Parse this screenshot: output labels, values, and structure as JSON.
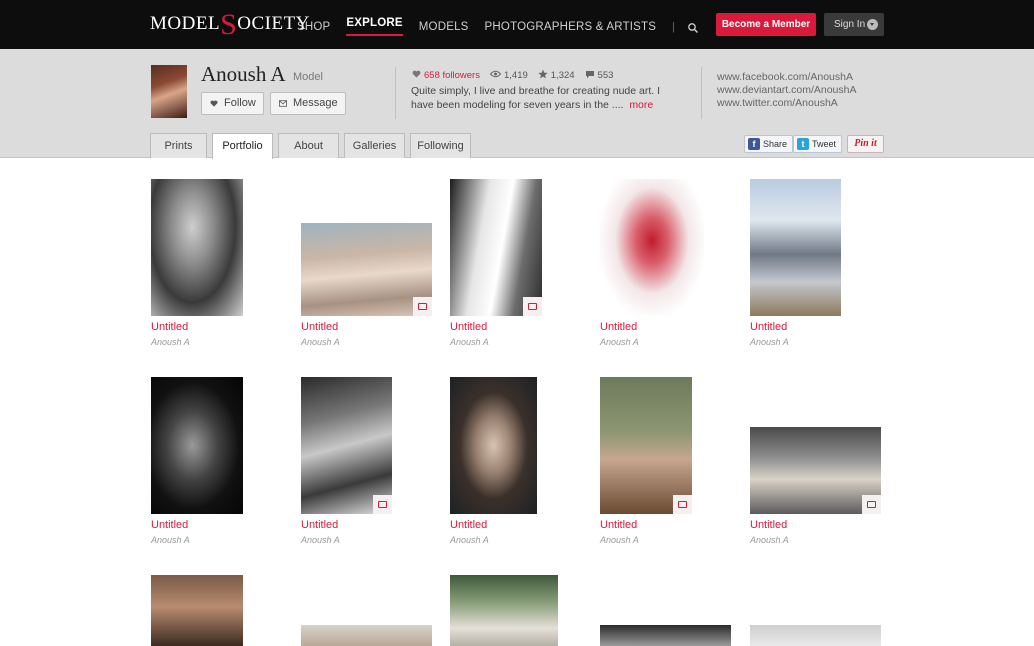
{
  "header": {
    "logo_left": "MODEL",
    "logo_s": "S",
    "logo_right": "OCIETY",
    "nav": [
      "SHOP",
      "EXPLORE",
      "MODELS",
      "PHOTOGRAPHERS & ARTISTS"
    ],
    "nav_active": "EXPLORE",
    "separator": "|",
    "member_button": "Become a Member",
    "signin_button": "Sign In"
  },
  "profile": {
    "name": "Anoush A",
    "role": "Model",
    "follow_label": "Follow",
    "message_label": "Message",
    "followers": "658 followers",
    "views": "1,419",
    "stars": "1,324",
    "comments": "553",
    "bio_line1": "Quite simply, I live and breathe for creating nude art. I",
    "bio_line2": "have been modeling for seven years in the ....",
    "more_label": "more",
    "links": [
      "www.facebook.com/AnoushA",
      "www.deviantart.com/AnoushA",
      "www.twitter.com/AnoushA"
    ]
  },
  "tabs": [
    "Prints",
    "Portfolio",
    "About",
    "Galleries",
    "Following"
  ],
  "active_tab": "Portfolio",
  "share": {
    "facebook": "Share",
    "twitter": "Tweet",
    "pinterest": "Pin it"
  },
  "colors": {
    "accent": "#d91a3c",
    "topbar": "#0d0d0d",
    "profile_bg": "#dcdcdc"
  },
  "portfolio": [
    {
      "title": "Untitled",
      "author": "Anoush A"
    },
    {
      "title": "Untitled",
      "author": "Anoush A"
    },
    {
      "title": "Untitled",
      "author": "Anoush A"
    },
    {
      "title": "Untitled",
      "author": "Anoush A"
    },
    {
      "title": "Untitled",
      "author": "Anoush A"
    },
    {
      "title": "Untitled",
      "author": "Anoush A"
    },
    {
      "title": "Untitled",
      "author": "Anoush A"
    },
    {
      "title": "Untitled",
      "author": "Anoush A"
    },
    {
      "title": "Untitled",
      "author": "Anoush A"
    },
    {
      "title": "Untitled",
      "author": "Anoush A"
    }
  ]
}
